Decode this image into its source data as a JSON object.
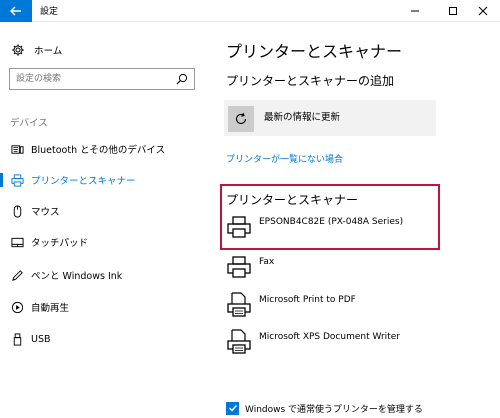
{
  "window": {
    "title": "設定"
  },
  "sidebar": {
    "home_label": "ホーム",
    "search_placeholder": "設定の検索",
    "section_label": "デバイス",
    "items": [
      {
        "label": "Bluetooth とその他のデバイス",
        "icon": "keyboard-icon"
      },
      {
        "label": "プリンターとスキャナー",
        "icon": "printer-icon",
        "selected": true
      },
      {
        "label": "マウス",
        "icon": "mouse-icon"
      },
      {
        "label": "タッチパッド",
        "icon": "touchpad-icon"
      },
      {
        "label": "ペンと Windows Ink",
        "icon": "pen-icon"
      },
      {
        "label": "自動再生",
        "icon": "autoplay-icon"
      },
      {
        "label": "USB",
        "icon": "usb-icon"
      }
    ]
  },
  "main": {
    "title": "プリンターとスキャナー",
    "add_heading": "プリンターとスキャナーの追加",
    "refresh_label": "最新の情報に更新",
    "not_listed_link": "プリンターが一覧にない場合",
    "list_heading": "プリンターとスキャナー",
    "printers": [
      {
        "name": "EPSONB4C82E (PX-048A Series)",
        "icon": "printer-icon"
      },
      {
        "name": "Fax",
        "icon": "printer-icon"
      },
      {
        "name": "Microsoft Print to PDF",
        "icon": "pdf-printer-icon"
      },
      {
        "name": "Microsoft XPS Document Writer",
        "icon": "pdf-printer-icon"
      }
    ],
    "default_checkbox_label": "Windows で通常使うプリンターを管理する",
    "default_checkbox_checked": true
  },
  "colors": {
    "accent": "#0078d7",
    "highlight_border": "#c0143c"
  }
}
